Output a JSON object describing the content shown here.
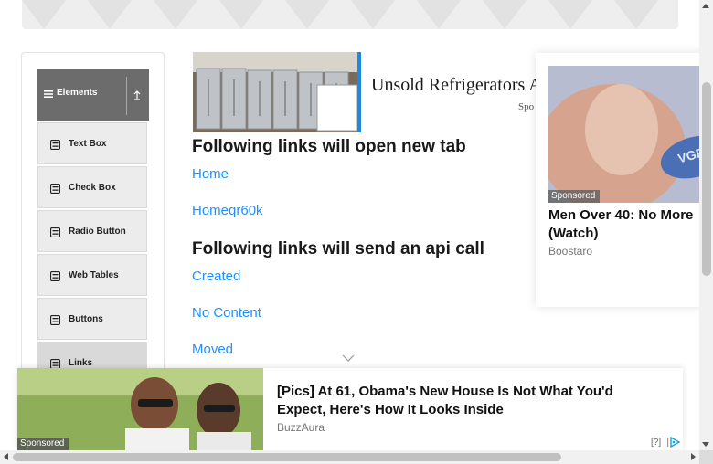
{
  "sidebar": {
    "group_title": "Elements",
    "items": [
      {
        "label": "Text Box",
        "icon": "form-icon"
      },
      {
        "label": "Check Box",
        "icon": "form-icon"
      },
      {
        "label": "Radio Button",
        "icon": "form-icon"
      },
      {
        "label": "Web Tables",
        "icon": "form-icon"
      },
      {
        "label": "Buttons",
        "icon": "form-icon"
      },
      {
        "label": "Links",
        "icon": "form-icon"
      }
    ]
  },
  "ad_fridge": {
    "title": "Unsold Refrigerators A",
    "sponsor": "Spo"
  },
  "main": {
    "new_tab_heading": "Following links will open new tab",
    "new_tab_links": [
      "Home",
      "Homeqr60k"
    ],
    "api_heading": "Following links will send an api call",
    "api_links": [
      "Created",
      "No Content",
      "Moved"
    ]
  },
  "ad_right": {
    "badge": "Sponsored",
    "title": "Men Over 40: No More (Watch)",
    "source": "Boostaro"
  },
  "ad_bottom": {
    "badge": "Sponsored",
    "title": "[Pics] At 61, Obama's New House Is Not What You'd Expect, Here's How It Looks Inside",
    "source": "BuzzAura",
    "help": "[?]"
  },
  "colors": {
    "link": "#1e90ff",
    "sidebar_header": "#6c6c6c",
    "ad_accent": "#1e88e5"
  }
}
